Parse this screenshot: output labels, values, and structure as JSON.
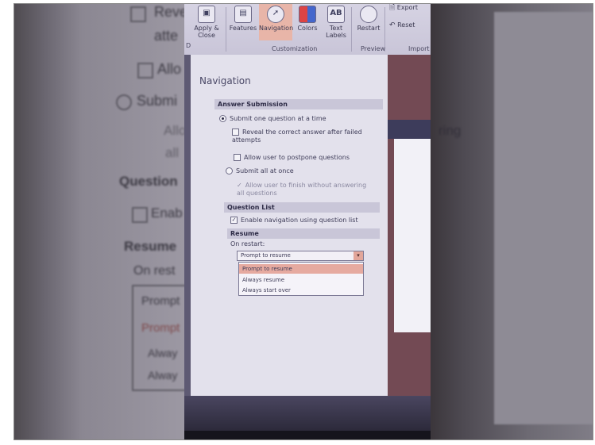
{
  "bg_left": {
    "lines": [
      "Reve",
      "atte",
      "Allo",
      "Submi",
      "Allo",
      "all",
      "Question",
      "Enab",
      "Resume",
      "On rest",
      "Prompt",
      "Prompt",
      "Alway",
      "Alway"
    ]
  },
  "bg_right": {
    "lines": [
      "ring"
    ]
  },
  "ribbon": {
    "buttons": [
      {
        "label": "Apply & Close"
      },
      {
        "label": "Features"
      },
      {
        "label": "Navigation"
      },
      {
        "label": "Colors"
      },
      {
        "label": "Text Labels"
      },
      {
        "label": "Restart"
      },
      {
        "label": "Export"
      },
      {
        "label": "Reset"
      }
    ],
    "groups": {
      "customization": "Customization",
      "preview": "Preview",
      "import": "Import"
    },
    "cut_group": "D"
  },
  "panel": {
    "title": "Navigation",
    "answer_submission": {
      "header": "Answer Submission",
      "submit_one": "Submit one question at a time",
      "reveal_correct": "Reveal the correct answer after failed attempts",
      "allow_postpone": "Allow user to postpone questions",
      "submit_all": "Submit all at once",
      "allow_finish": "Allow user to finish without answering all questions"
    },
    "question_list": {
      "header": "Question List",
      "enable_nav": "Enable navigation using question list"
    },
    "resume": {
      "header": "Resume",
      "on_restart_label": "On restart:",
      "selected": "Prompt to resume",
      "options": [
        "Prompt to resume",
        "Always resume",
        "Always start over"
      ]
    }
  }
}
